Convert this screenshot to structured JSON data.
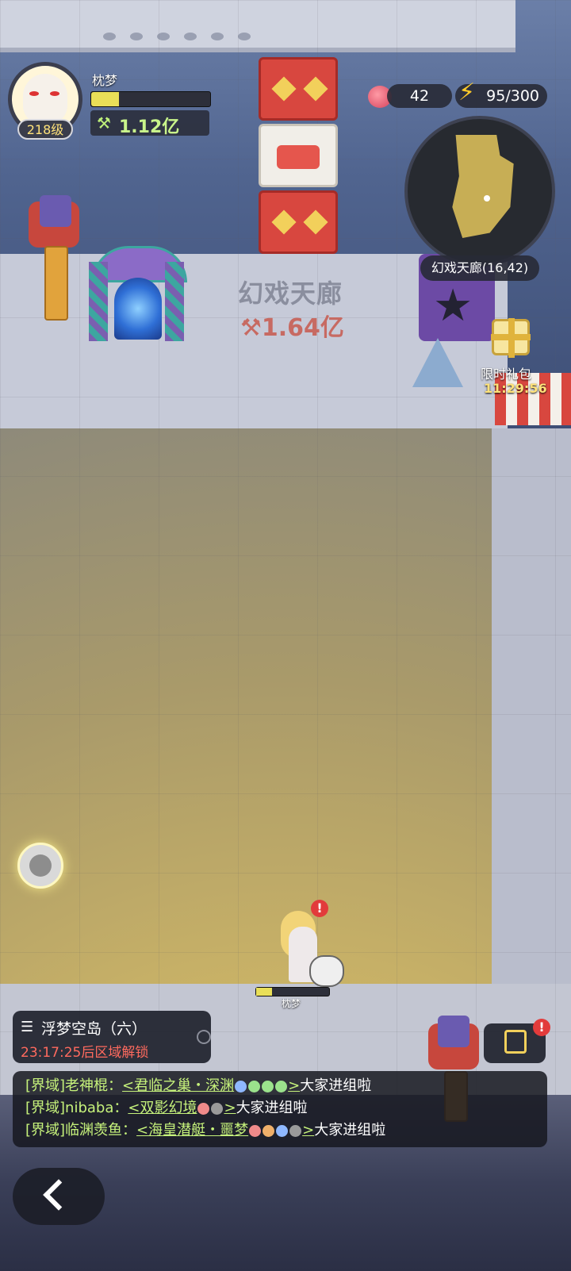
{
  "player": {
    "name": "枕梦",
    "level": "218级",
    "power": "1.12亿",
    "exp_progress": 0.23
  },
  "resources": {
    "peach_count": "42",
    "stamina": "95/300"
  },
  "minimap": {
    "location": "幻戏天廊(16,42)"
  },
  "zone": {
    "name": "幻戏天廊",
    "power": "1.64亿"
  },
  "gift": {
    "label": "限时礼包",
    "timer": "11:29:56"
  },
  "character": {
    "name": "枕梦",
    "hp_progress": 0.22,
    "alert": "!"
  },
  "quest": {
    "title": "浮梦空岛（六）",
    "subtitle": "23:17:25后区域解锁"
  },
  "bag": {
    "alert": "!"
  },
  "chat": [
    {
      "channel": "[界域]老神棍：",
      "link": "<君临之巢・深渊",
      "gem_colors": [
        "#8fb8ff",
        "#9be28c",
        "#9be28c",
        "#9be28c"
      ],
      "link_end": ">",
      "tail": "大家进组啦"
    },
    {
      "channel": "[界域]nibaba：",
      "link": "<双影幻境",
      "gem_colors": [
        "#f08a8a",
        "#9a9a9a"
      ],
      "link_end": ">",
      "tail": "大家进组啦"
    },
    {
      "channel": "[界域]临渊羡鱼：",
      "link": "<海皇潜艇・噩梦",
      "gem_colors": [
        "#f08a8a",
        "#f0b06a",
        "#8fb8ff",
        "#9a9a9a"
      ],
      "link_end": ">",
      "tail": "大家进组啦"
    }
  ],
  "icons": [
    "quest-list-icon",
    "target-icon",
    "bag-box-icon",
    "back-arrow-icon",
    "peach-icon",
    "lightning-icon",
    "gift-box-icon",
    "power-icon"
  ]
}
